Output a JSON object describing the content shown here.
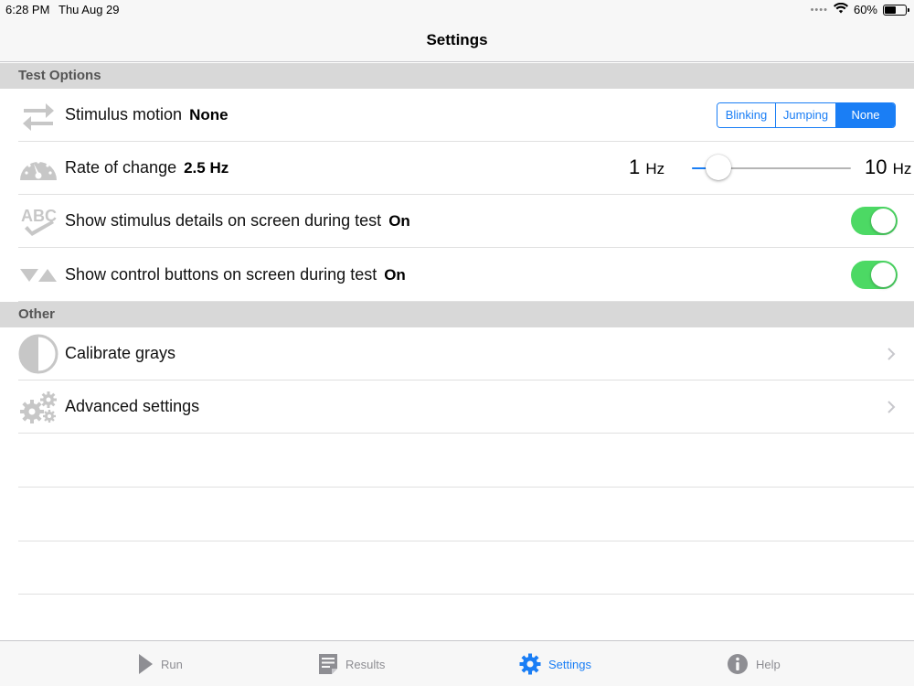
{
  "status_bar": {
    "time": "6:28 PM",
    "date": "Thu Aug 29",
    "battery": "60%",
    "battery_level": 0.6
  },
  "nav": {
    "title": "Settings"
  },
  "sections": {
    "test_options": "Test Options",
    "other": "Other"
  },
  "stimulus_motion": {
    "label": "Stimulus motion",
    "value": "None",
    "icon": "swap-arrows-icon",
    "options": [
      "Blinking",
      "Jumping",
      "None"
    ],
    "selected": "None"
  },
  "rate_of_change": {
    "label": "Rate of change",
    "value": "2.5 Hz",
    "icon": "speedometer-icon",
    "slider": {
      "min_value": "1",
      "max_value": "10",
      "unit": "Hz",
      "min": 1,
      "max": 10,
      "current": 2.5
    }
  },
  "show_details": {
    "label": "Show stimulus details on screen during test",
    "value": "On",
    "icon": "abc-check-icon",
    "toggle": true
  },
  "show_controls": {
    "label": "Show control buttons on screen during test",
    "value": "On",
    "icon": "triangles-icon",
    "toggle": true
  },
  "calibrate": {
    "label": "Calibrate grays",
    "icon": "half-circle-icon"
  },
  "advanced": {
    "label": "Advanced settings",
    "icon": "gears-icon"
  },
  "tabs": [
    {
      "label": "Run",
      "icon": "play-icon",
      "active": false
    },
    {
      "label": "Results",
      "icon": "document-icon",
      "active": false
    },
    {
      "label": "Settings",
      "icon": "gear-icon",
      "active": true
    },
    {
      "label": "Help",
      "icon": "info-icon",
      "active": false
    }
  ],
  "colors": {
    "accent": "#1a7ef5",
    "toggle_on": "#4cd964",
    "icon_gray": "#c7c7c7"
  }
}
